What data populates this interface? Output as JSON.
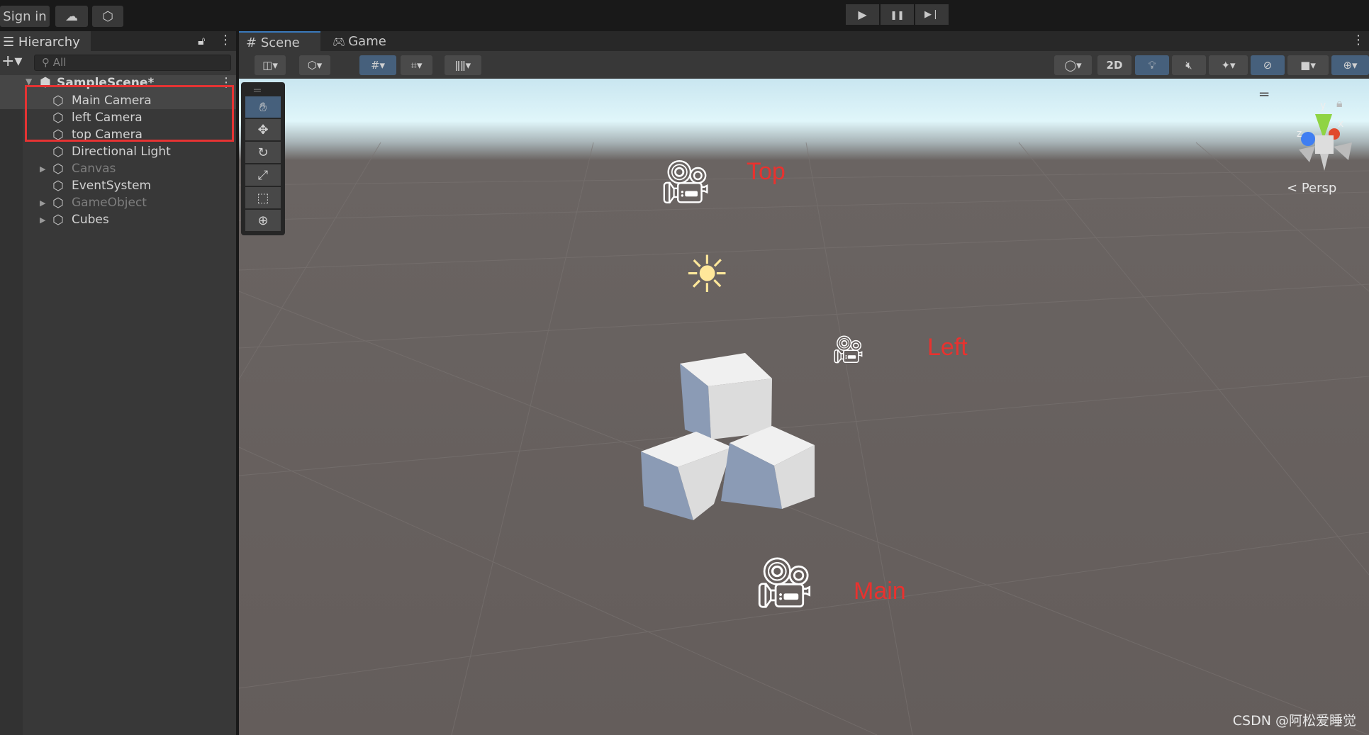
{
  "topbar": {
    "sign_in": "Sign in",
    "cloud_icon": "cloud-icon",
    "collab_icon": "collab-icon",
    "play_icon": "▶",
    "pause_icon": "❚❚",
    "step_icon": "▶❘"
  },
  "hierarchy": {
    "title": "Hierarchy",
    "search_placeholder": "All",
    "scene": "SampleScene*",
    "items": [
      {
        "label": "Main Camera"
      },
      {
        "label": "left Camera"
      },
      {
        "label": "top Camera"
      },
      {
        "label": "Directional Light"
      },
      {
        "label": "Canvas",
        "inactive": true,
        "expandable": true
      },
      {
        "label": "EventSystem"
      },
      {
        "label": "GameObject",
        "inactive": true,
        "expandable": true
      },
      {
        "label": "Cubes",
        "expandable": true
      }
    ]
  },
  "tabs": {
    "scene": "Scene",
    "game": "Game"
  },
  "toolbar": {
    "two_d": "2D"
  },
  "scene": {
    "persp": "Persp",
    "gizmo_x": "x",
    "gizmo_y": "y",
    "gizmo_z": "z",
    "labels": {
      "top": "Top",
      "left": "Left",
      "main": "Main"
    }
  },
  "watermark": "CSDN @阿松爱睡觉",
  "colors": {
    "annotation": "#e8322f",
    "selected_tool": "#46607c"
  }
}
